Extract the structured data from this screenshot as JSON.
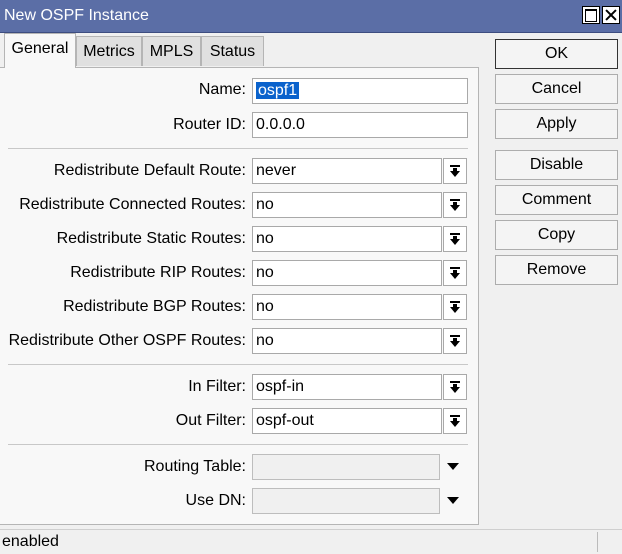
{
  "window": {
    "title": "New OSPF Instance"
  },
  "tabs": [
    "General",
    "Metrics",
    "MPLS",
    "Status"
  ],
  "fields": {
    "name": {
      "label": "Name:",
      "value": "ospf1"
    },
    "router_id": {
      "label": "Router ID:",
      "value": "0.0.0.0"
    },
    "redistribute_default": {
      "label": "Redistribute Default Route:",
      "value": "never"
    },
    "redistribute_connected": {
      "label": "Redistribute Connected Routes:",
      "value": "no"
    },
    "redistribute_static": {
      "label": "Redistribute Static Routes:",
      "value": "no"
    },
    "redistribute_rip": {
      "label": "Redistribute RIP Routes:",
      "value": "no"
    },
    "redistribute_bgp": {
      "label": "Redistribute BGP Routes:",
      "value": "no"
    },
    "redistribute_other_ospf": {
      "label": "Redistribute Other OSPF Routes:",
      "value": "no"
    },
    "in_filter": {
      "label": "In Filter:",
      "value": "ospf-in"
    },
    "out_filter": {
      "label": "Out Filter:",
      "value": "ospf-out"
    },
    "routing_table": {
      "label": "Routing Table:",
      "value": ""
    },
    "use_dn": {
      "label": "Use DN:",
      "value": ""
    }
  },
  "buttons": {
    "ok": "OK",
    "cancel": "Cancel",
    "apply": "Apply",
    "disable": "Disable",
    "comment": "Comment",
    "copy": "Copy",
    "remove": "Remove"
  },
  "status": {
    "text": "enabled"
  }
}
